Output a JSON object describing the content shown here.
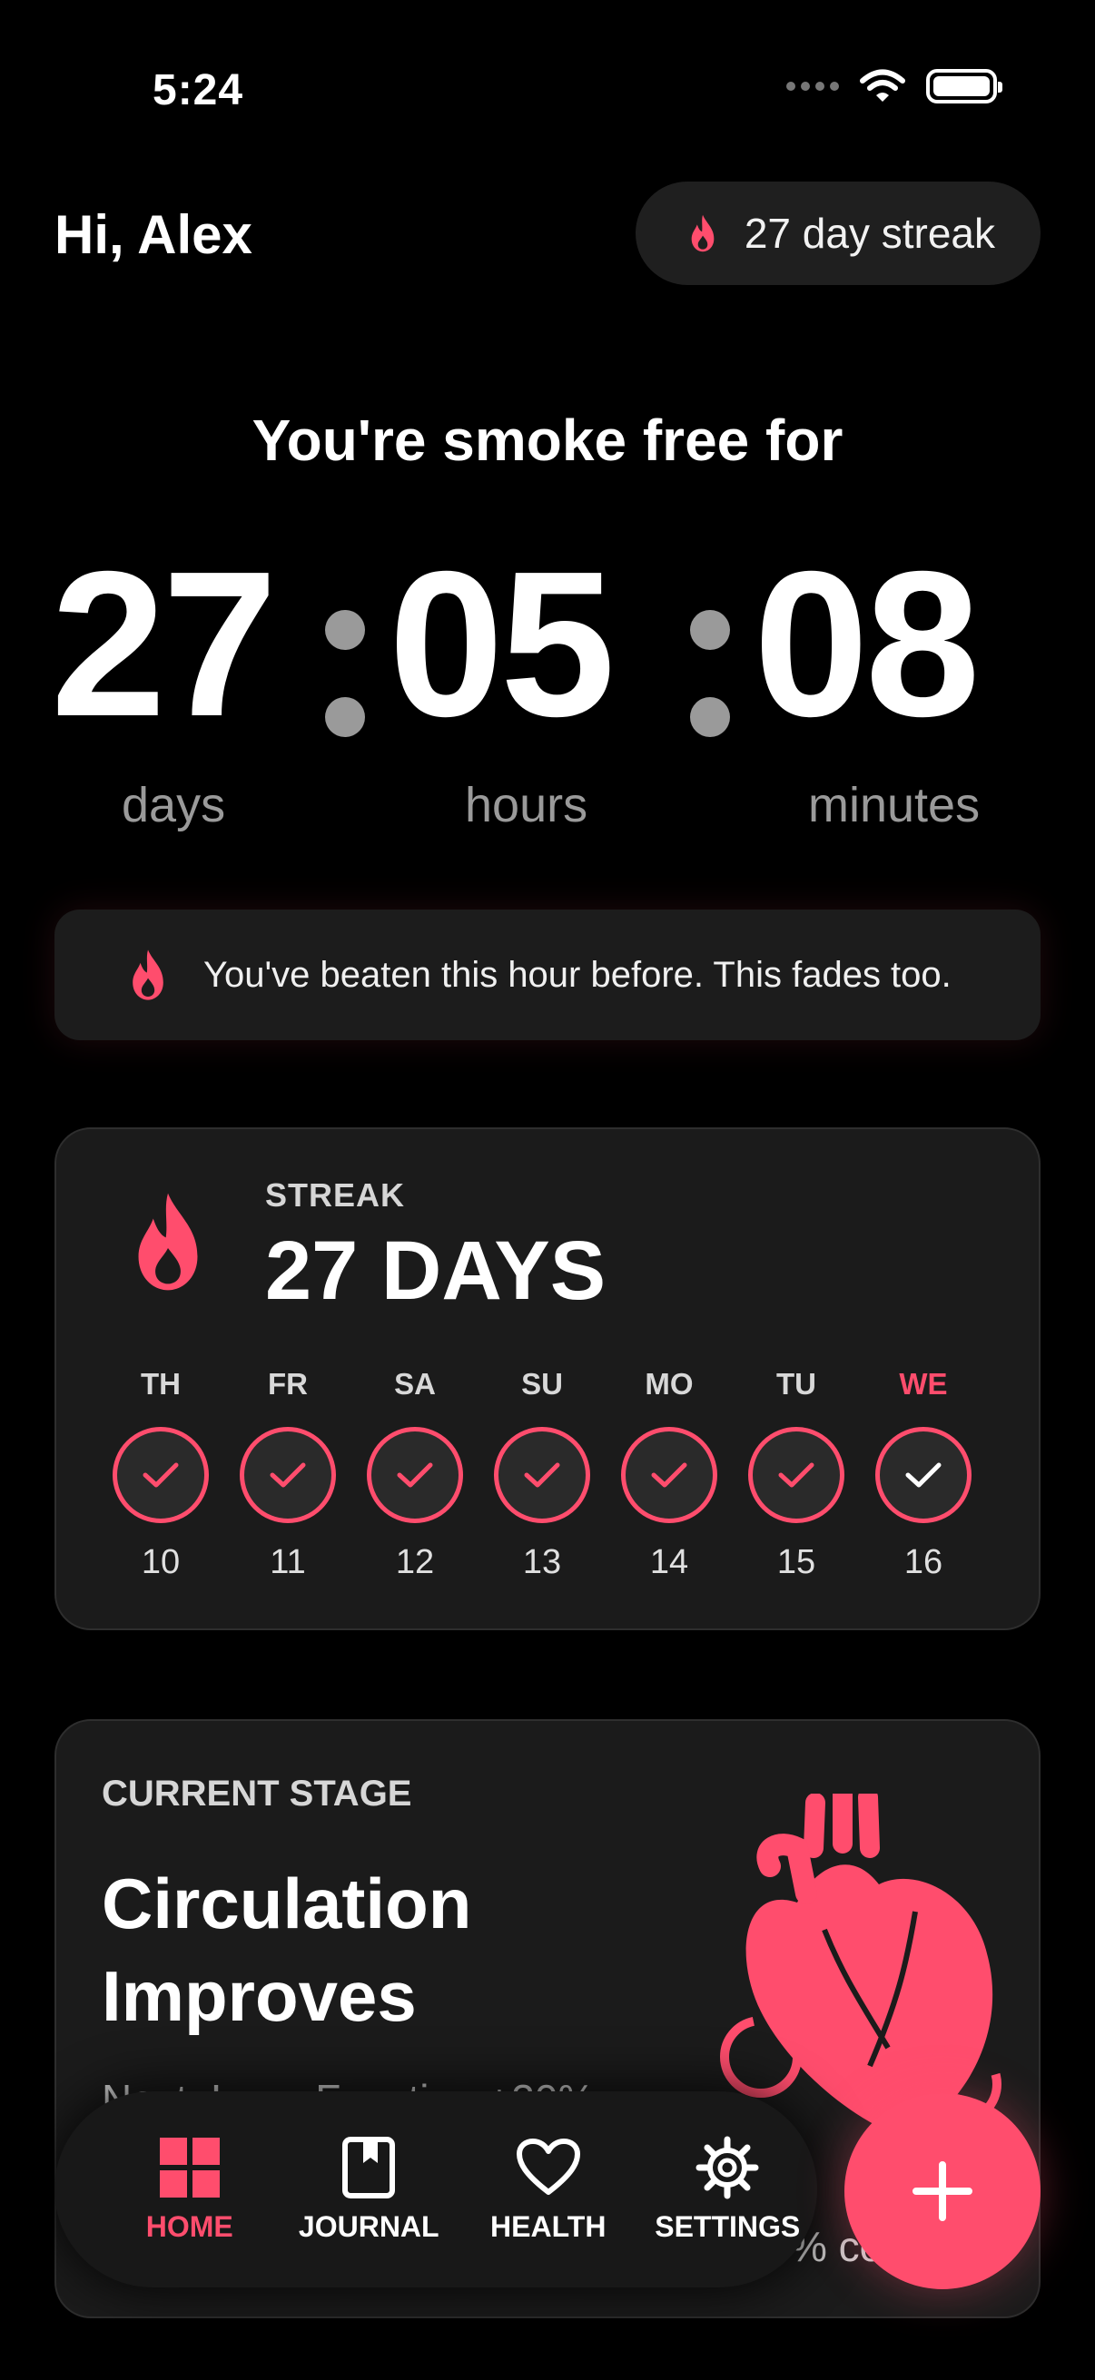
{
  "status_bar": {
    "time": "5:24"
  },
  "header": {
    "greeting": "Hi, Alex",
    "streak_badge": "27 day streak"
  },
  "timer": {
    "title": "You're smoke free for",
    "days": "27",
    "hours": "05",
    "minutes": "08",
    "days_label": "days",
    "hours_label": "hours",
    "minutes_label": "minutes"
  },
  "banner": {
    "text": "You've beaten this hour before. This fades too."
  },
  "streak": {
    "label": "STREAK",
    "value": "27 DAYS",
    "days": [
      {
        "name": "TH",
        "num": "10",
        "today": false
      },
      {
        "name": "FR",
        "num": "11",
        "today": false
      },
      {
        "name": "SA",
        "num": "12",
        "today": false
      },
      {
        "name": "SU",
        "num": "13",
        "today": false
      },
      {
        "name": "MO",
        "num": "14",
        "today": false
      },
      {
        "name": "TU",
        "num": "15",
        "today": false
      },
      {
        "name": "WE",
        "num": "16",
        "today": true
      }
    ]
  },
  "stage": {
    "label": "CURRENT STAGE",
    "title": "Circulation Improves",
    "next": "Next: Lung Function +30%",
    "pct_fragment": "% co"
  },
  "tabs": [
    {
      "label": "HOME",
      "icon": "grid-icon",
      "active": true
    },
    {
      "label": "JOURNAL",
      "icon": "journal-icon",
      "active": false
    },
    {
      "label": "HEALTH",
      "icon": "heart-icon",
      "active": false
    },
    {
      "label": "SETTINGS",
      "icon": "gear-icon",
      "active": false
    }
  ],
  "fab": {
    "icon": "plus-icon"
  },
  "colors": {
    "accent": "#ff4d6d",
    "background": "#000000",
    "card": "#1b1b1b"
  }
}
